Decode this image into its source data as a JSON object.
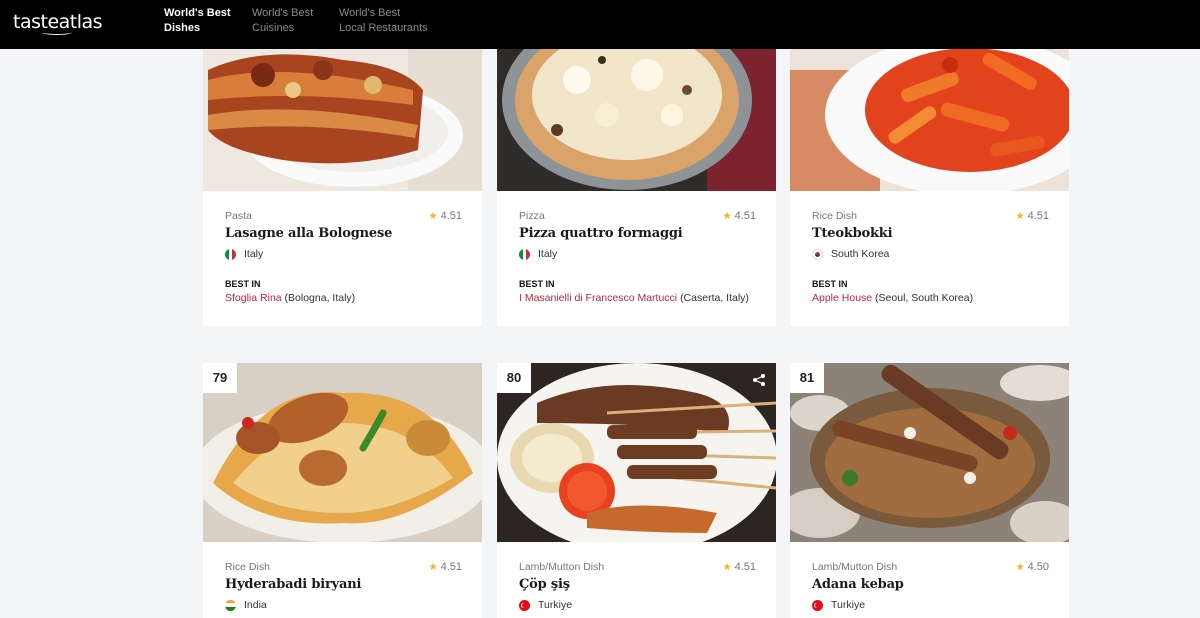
{
  "header": {
    "logo": "tasteatlas",
    "nav": [
      {
        "line1": "World's Best",
        "line2": "Dishes",
        "active": true
      },
      {
        "line1": "World's Best",
        "line2": "Cuisines",
        "active": false
      },
      {
        "line1": "World's Best",
        "line2": "Local Restaurants",
        "active": false
      }
    ]
  },
  "best_in_label": "BEST IN",
  "cards": [
    {
      "category": "Pasta",
      "name": "Lasagne alla Bolognese",
      "rating": "4.51",
      "country": "Italy",
      "flag": "italy-flag-icon",
      "best_place": "Sfoglia Rina",
      "best_location": "(Bologna, Italy)"
    },
    {
      "category": "Pizza",
      "name": "Pizza quattro formaggi",
      "rating": "4.51",
      "country": "Italy",
      "flag": "italy-flag-icon",
      "best_place": "I Masanielli di Francesco Martucci",
      "best_location": "(Caserta, Italy)"
    },
    {
      "category": "Rice Dish",
      "name": "Tteokbokki",
      "rating": "4.51",
      "country": "South Korea",
      "flag": "south-korea-flag-icon",
      "best_place": "Apple House",
      "best_location": "(Seoul, South Korea)"
    },
    {
      "rank": "79",
      "category": "Rice Dish",
      "name": "Hyderabadi biryani",
      "rating": "4.51",
      "country": "India",
      "flag": "india-flag-icon"
    },
    {
      "rank": "80",
      "category": "Lamb/Mutton Dish",
      "name": "Çöp şiş",
      "rating": "4.51",
      "country": "Turkiye",
      "flag": "turkiye-flag-icon"
    },
    {
      "rank": "81",
      "category": "Lamb/Mutton Dish",
      "name": "Adana kebap",
      "rating": "4.50",
      "country": "Turkiye",
      "flag": "turkiye-flag-icon"
    }
  ]
}
